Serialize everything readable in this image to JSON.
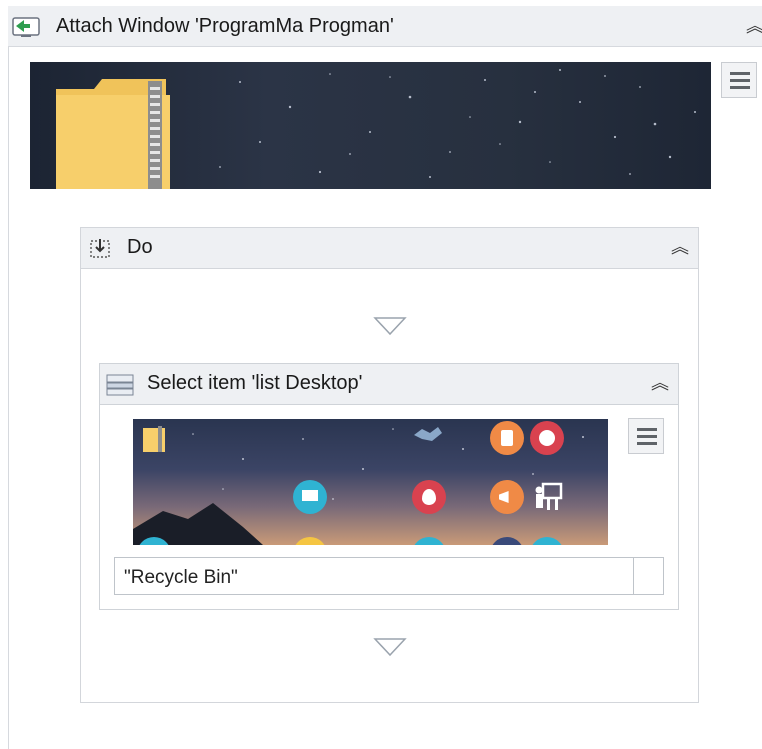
{
  "attach_window": {
    "title": "Attach Window 'ProgramMa Progman'",
    "icon": "attach-window-icon",
    "collapse_icon": "double-chevron-up-icon"
  },
  "do_scope": {
    "title": "Do",
    "icon": "do-sequence-icon",
    "collapse_icon": "double-chevron-up-icon"
  },
  "select_item": {
    "title": "Select item 'list  Desktop'",
    "icon": "select-item-icon",
    "collapse_icon": "double-chevron-up-icon",
    "item_value": "\"Recycle Bin\""
  },
  "drop_indicator_icon": "triangle-down-icon",
  "menu_icon": "hamburger-menu-icon",
  "colors": {
    "header_bg": "#eef0f3",
    "border": "#d3d6db",
    "folder_yellow": "#f7cf6b"
  }
}
